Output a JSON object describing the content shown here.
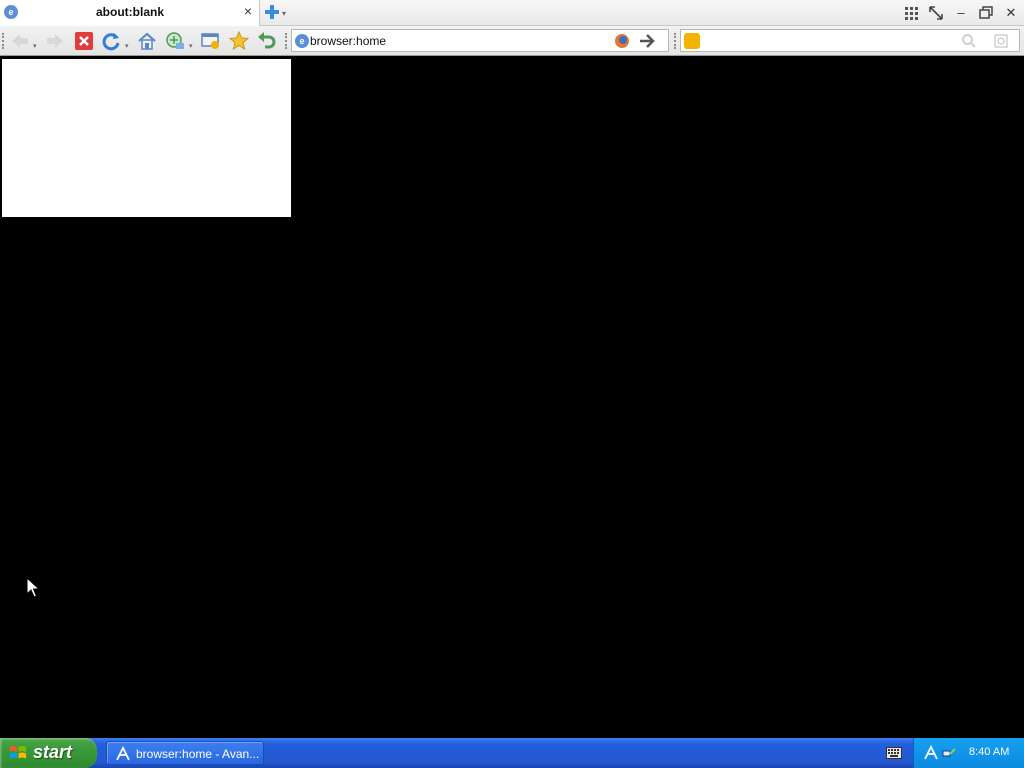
{
  "browser": {
    "tab": {
      "title": "about:blank",
      "close_glyph": "×"
    },
    "window_controls": {
      "minimize_glyph": "–",
      "close_glyph": "✕"
    },
    "address_bar": {
      "value": "browser:home"
    },
    "search_bar": {
      "value": ""
    }
  },
  "taskbar": {
    "start_label": "start",
    "task_label": "browser:home - Avan...",
    "clock": "8:40 AM"
  },
  "icons": {
    "tab_favicon": "browser-globe-icon",
    "new_tab": "plus-icon",
    "back": "back-arrow-icon",
    "forward": "forward-arrow-icon",
    "stop": "stop-icon",
    "reload": "reload-icon",
    "home": "home-icon",
    "feed": "feed-icon",
    "groups": "group-icon",
    "favorites": "star-icon",
    "undo": "undo-icon",
    "go": "go-arrow-icon",
    "search_engine": "search-engine-icon",
    "search": "magnifier-icon"
  },
  "colors": {
    "content_background": "#000000",
    "taskbar": "#245edb",
    "start_button": "#3a9a3a",
    "tray": "#0c8ae0"
  }
}
